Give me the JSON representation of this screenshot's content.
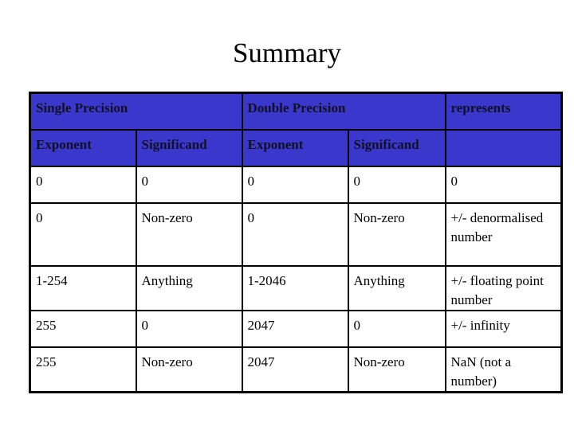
{
  "title": "Summary",
  "colors": {
    "header_bg": "#3a38cc"
  },
  "table": {
    "group_headers": {
      "single": "Single Precision",
      "double": "Double Precision",
      "represents": "represents"
    },
    "sub_headers": [
      "Exponent",
      "Significand",
      "Exponent",
      "Significand",
      ""
    ],
    "rows": [
      [
        "0",
        "0",
        "0",
        "0",
        "0"
      ],
      [
        "0",
        "Non-zero",
        "0",
        "Non-zero",
        "+/- denormalised number"
      ],
      [
        "1-254",
        "Anything",
        "1-2046",
        "Anything",
        "+/- floating point number"
      ],
      [
        "255",
        "0",
        "2047",
        "0",
        "+/- infinity"
      ],
      [
        "255",
        "Non-zero",
        "2047",
        "Non-zero",
        "NaN (not a number)"
      ]
    ]
  }
}
